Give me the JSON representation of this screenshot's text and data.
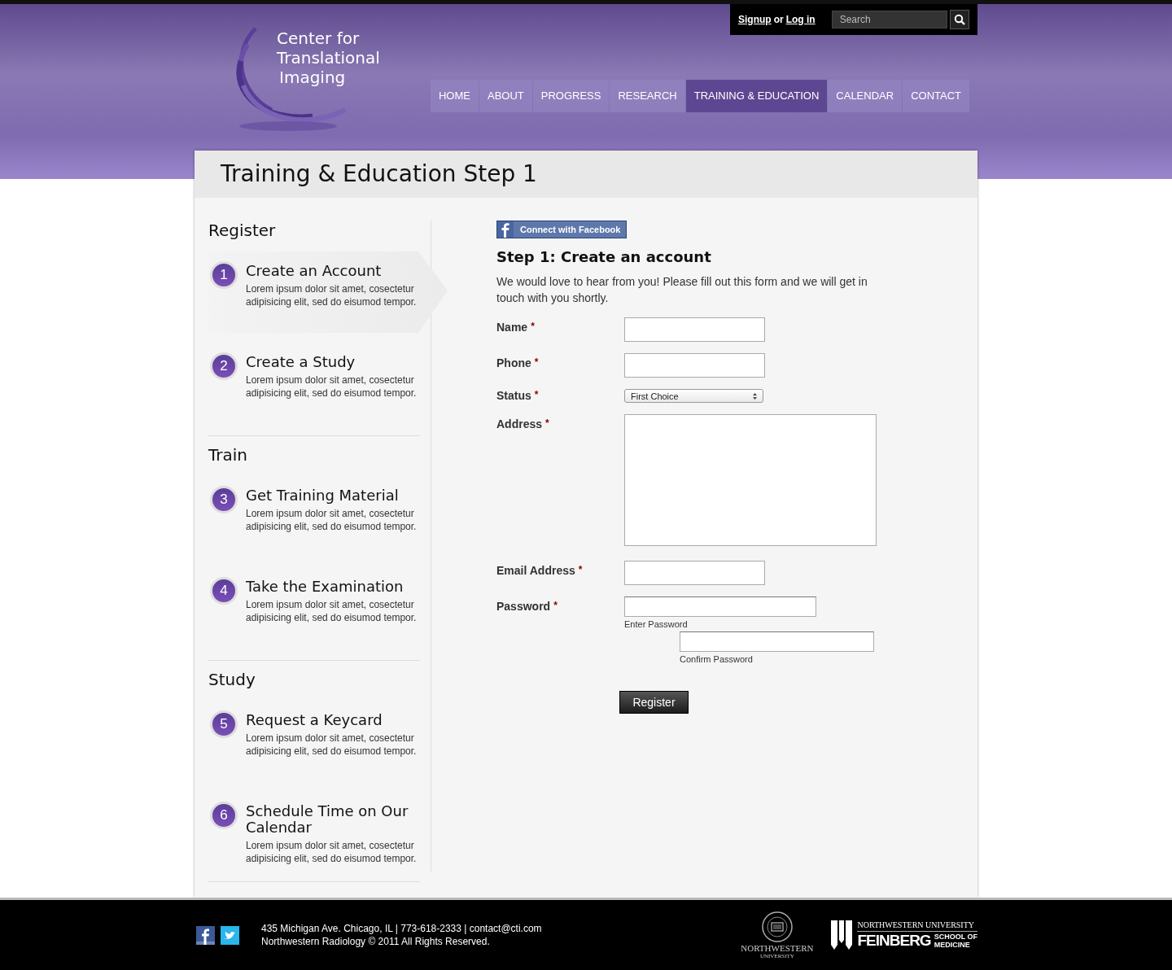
{
  "header": {
    "logo_lines": [
      "Center for",
      "Translational",
      "Imaging"
    ],
    "account": {
      "signup": "Signup",
      "separator": "or",
      "login": "Log in"
    },
    "search": {
      "placeholder": "Search"
    },
    "nav": [
      {
        "label": "HOME",
        "selected": false
      },
      {
        "label": "ABOUT",
        "selected": false
      },
      {
        "label": "PROGRESS",
        "selected": false
      },
      {
        "label": "RESEARCH",
        "selected": false
      },
      {
        "label": "TRAINING & EDUCATION",
        "selected": true
      },
      {
        "label": "CALENDAR",
        "selected": false
      },
      {
        "label": "CONTACT",
        "selected": false
      }
    ]
  },
  "page_title": "Training & Education Step 1",
  "sidebar": [
    {
      "heading": "Register",
      "steps": [
        {
          "number": "1",
          "title": "Create an Account",
          "text": "Lorem ipsum dolor sit amet, cosectetur adipisicing elit, sed do eisumod tempor.",
          "selected": true
        },
        {
          "number": "2",
          "title": "Create a Study",
          "text": "Lorem ipsum dolor sit amet, cosectetur adipisicing elit, sed do eisumod tempor.",
          "selected": false
        }
      ]
    },
    {
      "heading": "Train",
      "steps": [
        {
          "number": "3",
          "title": "Get Training Material",
          "text": "Lorem ipsum dolor sit amet, cosectetur adipisicing elit, sed do eisumod tempor.",
          "selected": false
        },
        {
          "number": "4",
          "title": "Take the Examination",
          "text": "Lorem ipsum dolor sit amet, cosectetur adipisicing elit, sed do eisumod tempor.",
          "selected": false
        }
      ]
    },
    {
      "heading": "Study",
      "steps": [
        {
          "number": "5",
          "title": "Request a Keycard",
          "text": "Lorem ipsum dolor sit amet, cosectetur adipisicing elit, sed do eisumod tempor.",
          "selected": false
        },
        {
          "number": "6",
          "title": "Schedule Time on Our Calendar",
          "text": "Lorem ipsum dolor sit amet, cosectetur adipisicing elit, sed do eisumod tempor.",
          "selected": false
        }
      ]
    }
  ],
  "form": {
    "facebook_button": "Connect with Facebook",
    "heading": "Step 1: Create an account",
    "intro": "We would love to hear from you! Please fill out this form and we will get in touch with you shortly.",
    "fields": [
      {
        "kind": "text",
        "label": "Name",
        "required_mark": "*"
      },
      {
        "kind": "text",
        "label": "Phone",
        "required_mark": "*"
      },
      {
        "kind": "select",
        "label": "Status",
        "required_mark": "*",
        "value": "First Choice"
      },
      {
        "kind": "textarea",
        "label": "Address",
        "required_mark": "*"
      },
      {
        "kind": "text",
        "label": "Email Address",
        "required_mark": "*"
      },
      {
        "kind": "password",
        "label": "Password",
        "required_mark": "*",
        "hint": "Enter Password",
        "confirm_hint": "Confirm Password"
      }
    ],
    "submit": "Register"
  },
  "footer": {
    "address": "435 Michigan Ave. Chicago, IL | 773-618-2333 | contact@cti.com",
    "copyright": "Northwestern Radiology © 2011 All Rights Reserved.",
    "nu_logo": {
      "name": "NORTHWESTERN",
      "sub": "UNIVERSITY"
    },
    "feinberg_logo": {
      "top": "NORTHWESTERN UNIVERSITY",
      "name": "FEINBERG",
      "school_1": "SCHOOL OF",
      "school_2": "MEDICINE"
    }
  }
}
